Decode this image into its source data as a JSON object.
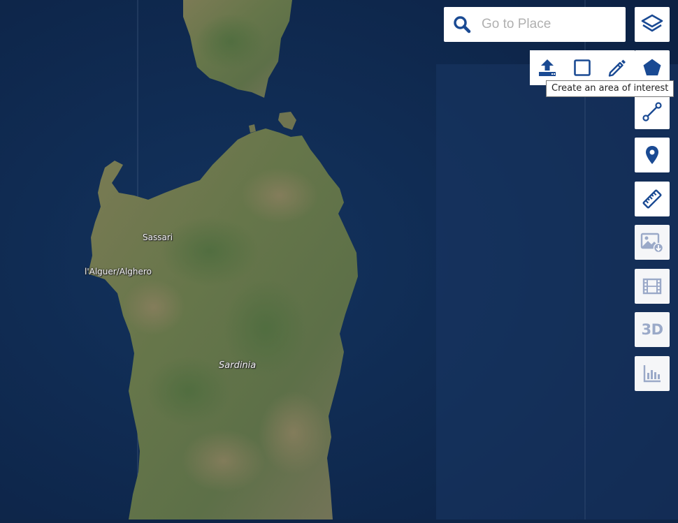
{
  "map": {
    "labels": {
      "sassari": "Sassari",
      "alghero": "l'Alguer/Alghero",
      "sardinia": "Sardinia"
    }
  },
  "search": {
    "placeholder": "Go to Place",
    "icon": "search-icon"
  },
  "toolbar": {
    "accent_color": "#1a4a93",
    "disabled_color": "#9aa9c8",
    "buttons": [
      {
        "name": "layers-button",
        "icon": "layers-icon"
      },
      {
        "name": "create-aoi-button",
        "icon": "polygon-icon"
      },
      {
        "name": "measure-line-button",
        "icon": "line-icon"
      },
      {
        "name": "add-marker-button",
        "icon": "map-pin-icon"
      },
      {
        "name": "measure-ruler-button",
        "icon": "ruler-icon"
      },
      {
        "name": "download-image-button",
        "icon": "image-download-icon"
      },
      {
        "name": "timelapse-button",
        "icon": "film-icon"
      },
      {
        "name": "3d-button",
        "icon": "3d-icon",
        "label": "3D"
      },
      {
        "name": "statistics-button",
        "icon": "bar-chart-icon"
      }
    ],
    "aoi_panel": [
      {
        "name": "upload-aoi-button",
        "icon": "upload-icon"
      },
      {
        "name": "rectangle-aoi-button",
        "icon": "square-icon"
      },
      {
        "name": "draw-aoi-button",
        "icon": "pencil-icon"
      }
    ]
  },
  "tooltip": {
    "text": "Create an area of interest"
  }
}
